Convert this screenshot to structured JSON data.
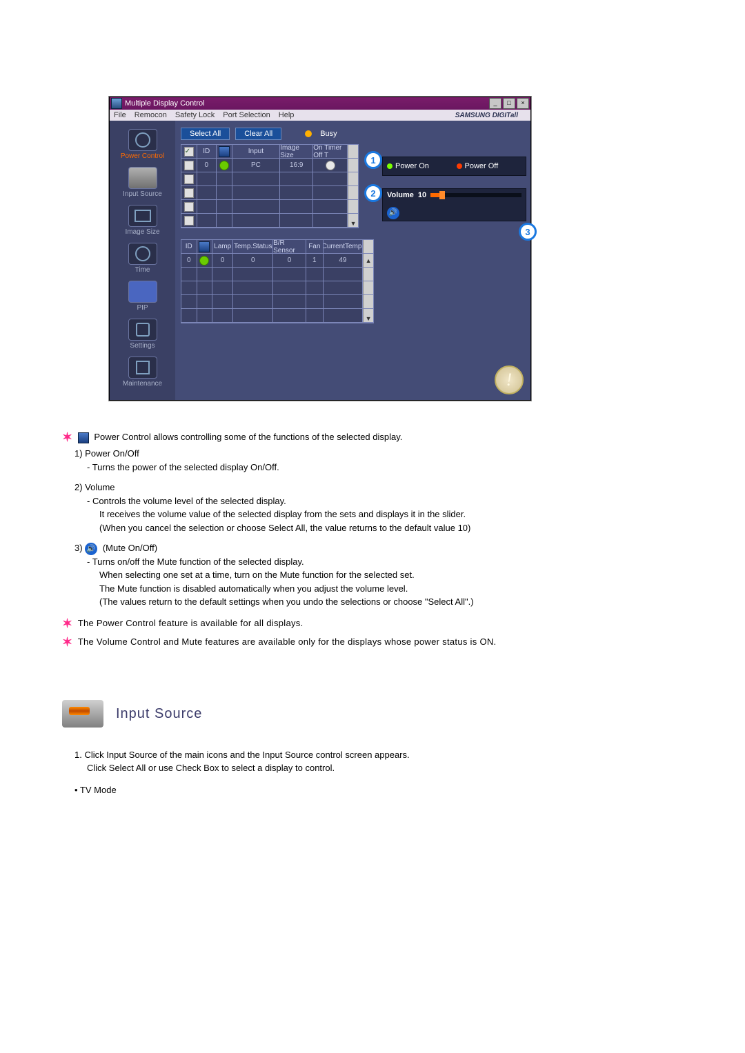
{
  "window": {
    "title": "Multiple Display Control",
    "brand": "SAMSUNG DIGITall"
  },
  "menu": {
    "file": "File",
    "remocon": "Remocon",
    "safety": "Safety Lock",
    "port": "Port Selection",
    "help": "Help"
  },
  "sidebar": {
    "power": "Power Control",
    "input": "Input Source",
    "image": "Image Size",
    "time": "Time",
    "pip": "PIP",
    "settings": "Settings",
    "maint": "Maintenance"
  },
  "toolbar": {
    "select_all": "Select All",
    "clear_all": "Clear All",
    "busy": "Busy"
  },
  "grid1": {
    "headers": {
      "id": "ID",
      "input": "Input",
      "imgsize": "Image Size",
      "timer": "On Timer Off T"
    },
    "row0": {
      "id": "0",
      "input": "PC",
      "imgsize": "16:9"
    }
  },
  "right": {
    "power_on": "Power On",
    "power_off": "Power Off",
    "volume_label": "Volume",
    "volume_value": "10"
  },
  "callouts": {
    "c1": "1",
    "c2": "2",
    "c3": "3"
  },
  "grid2": {
    "headers": {
      "id": "ID",
      "lamp": "Lamp",
      "ts": "Temp.Status",
      "br": "B/R Sensor",
      "fan": "Fan",
      "ct": "CurrentTemp."
    },
    "row0": {
      "id": "0",
      "lamp": "0",
      "ts": "0",
      "br": "0",
      "fan": "1",
      "ct": "49"
    }
  },
  "big_info": "!",
  "doc": {
    "l0": "Power Control allows controlling some of the functions of the selected display.",
    "l1": "1)  Power On/Off",
    "l1a": "- Turns the power of the selected display On/Off.",
    "l2": "2)  Volume",
    "l2a": "- Controls the volume level of the selected display.",
    "l2b": "It receives the volume value of the selected display from the sets and displays it in the slider.",
    "l2c": "(When you cancel the selection or choose Select All, the value returns to the default value 10)",
    "l3": "3)",
    "l3label": "(Mute On/Off)",
    "l3a": "- Turns on/off the Mute function of the selected display.",
    "l3b": "When selecting one set at a time, turn on the Mute function for the selected set.",
    "l3c": "The Mute function is disabled automatically when you adjust the volume level.",
    "l3d": "(The values return to the default settings when you undo the selections or choose \"Select All\".)",
    "note1": "The Power Control feature is available for all displays.",
    "note2": "The Volume Control and Mute features are available only for the displays whose power status is ON."
  },
  "section": {
    "title": "Input Source",
    "p1_a": "1.",
    "p1_b": "Click Input Source of the main icons and the Input Source control screen appears.",
    "p1_c": "Click Select All or use Check Box to select a display to control.",
    "bullet": "•  TV Mode"
  }
}
